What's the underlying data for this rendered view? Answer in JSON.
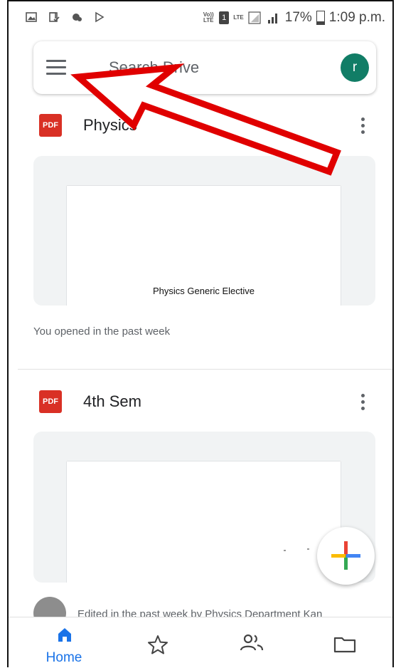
{
  "status_bar": {
    "volte": "Vo)) LTE",
    "sim": "1",
    "lte": "LTE",
    "battery": "17%",
    "time": "1:09 p.m."
  },
  "search": {
    "placeholder": "Search Drive"
  },
  "account": {
    "initial": "r"
  },
  "files": [
    {
      "type_badge": "PDF",
      "title": "Physics",
      "preview_text": "Physics Generic Elective",
      "reason": "You opened in the past week"
    },
    {
      "type_badge": "PDF",
      "title": "4th Sem",
      "preview_text": "",
      "reason": "Edited in the past week by Physics Department Kan"
    }
  ],
  "bottom_nav": [
    {
      "label": "Home",
      "icon": "home-icon",
      "active": true
    },
    {
      "label": "",
      "icon": "star-icon"
    },
    {
      "label": "",
      "icon": "shared-people-icon"
    },
    {
      "label": "",
      "icon": "folder-icon"
    }
  ],
  "colors": {
    "accent": "#1a73e8",
    "avatar": "#117d66",
    "pdf": "#d93025",
    "arrow": "#e00000"
  }
}
